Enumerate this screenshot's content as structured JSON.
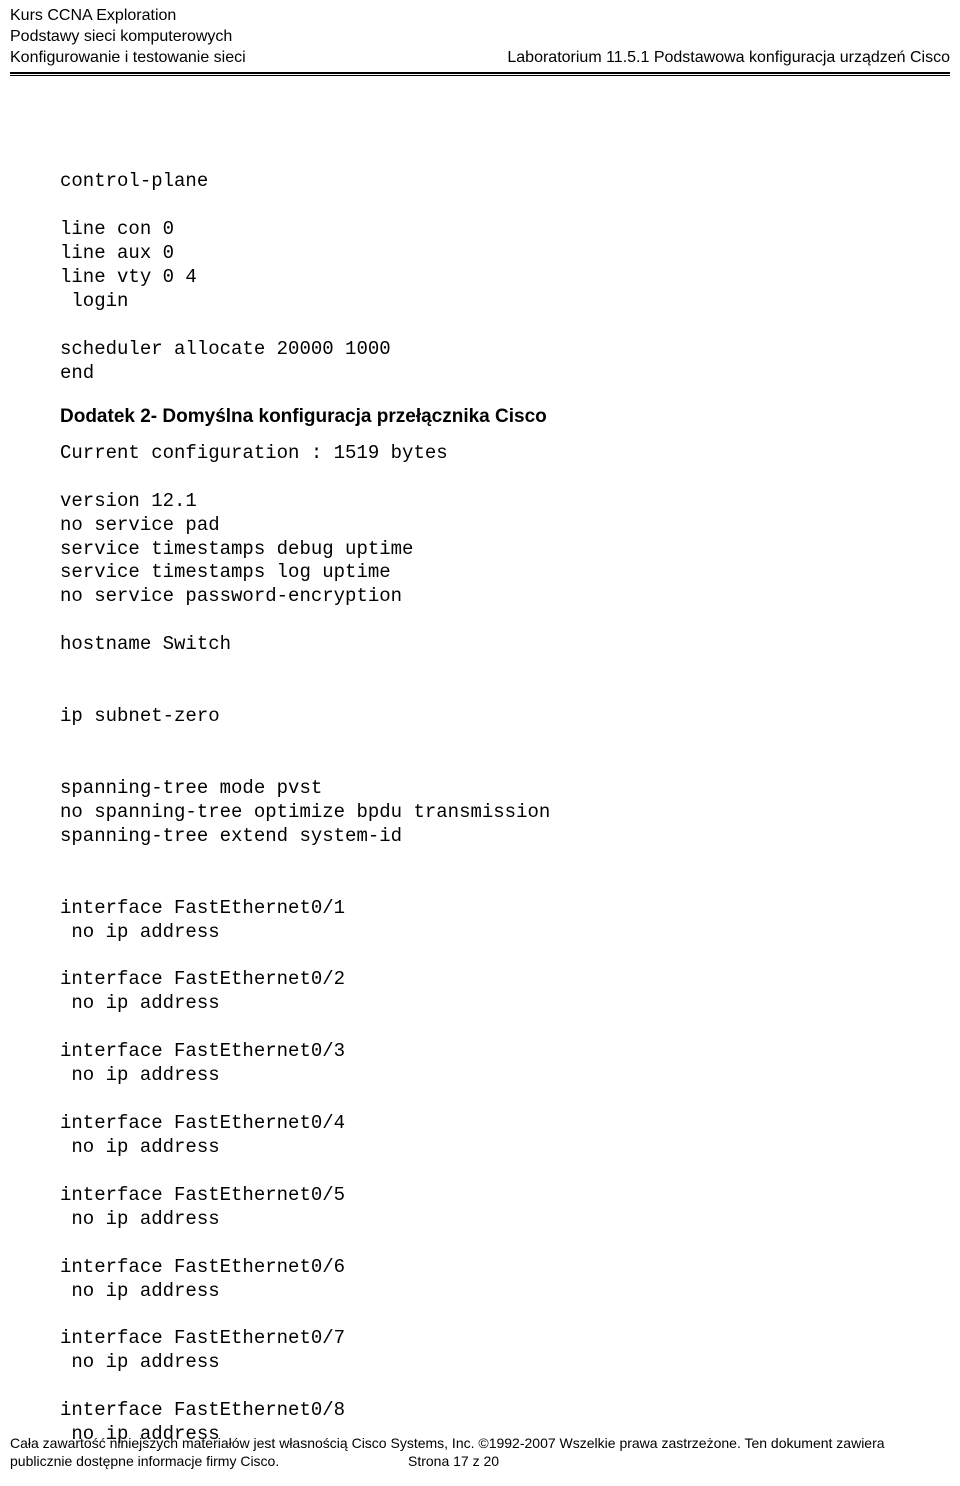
{
  "header": {
    "line1": "Kurs CCNA Exploration",
    "line2": "Podstawy sieci komputerowych",
    "line3_left": "Konfigurowanie i testowanie sieci",
    "line3_right": "Laboratorium 11.5.1 Podstawowa konfiguracja urządzeń Cisco"
  },
  "config_block_1": "\ncontrol-plane\n\nline con 0\nline aux 0\nline vty 0 4\n login\n\nscheduler allocate 20000 1000\nend",
  "appendix_title": "Dodatek 2- Domyślna konfiguracja przełącznika Cisco",
  "config_block_2": "Current configuration : 1519 bytes\n\nversion 12.1\nno service pad\nservice timestamps debug uptime\nservice timestamps log uptime\nno service password-encryption\n\nhostname Switch\n\n\nip subnet-zero\n\n\nspanning-tree mode pvst\nno spanning-tree optimize bpdu transmission\nspanning-tree extend system-id\n\n\ninterface FastEthernet0/1\n no ip address\n\ninterface FastEthernet0/2\n no ip address\n\ninterface FastEthernet0/3\n no ip address\n\ninterface FastEthernet0/4\n no ip address\n\ninterface FastEthernet0/5\n no ip address\n\ninterface FastEthernet0/6\n no ip address\n\ninterface FastEthernet0/7\n no ip address\n\ninterface FastEthernet0/8\n no ip address",
  "footer": {
    "line1_left": "Cała zawartość niniejszych materiałów jest własnością Cisco Systems, Inc. ©1992-2007 Wszelkie prawa zastrzeżone. Ten dokument zawiera",
    "line2_left": "publicznie dostępne informacje firmy Cisco.",
    "line2_right": "Strona 17 z 20"
  }
}
